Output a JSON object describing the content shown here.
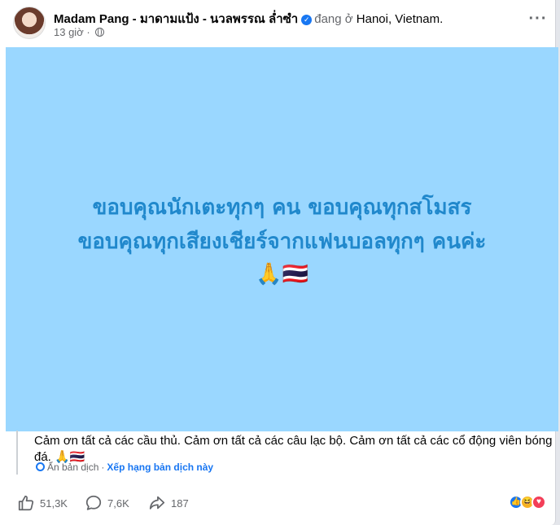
{
  "post": {
    "author": "Madam Pang - มาดามแป้ง - นวลพรรณ ล่ำซำ",
    "checkin_prefix": "đang ở",
    "location": "Hanoi, Vietnam",
    "location_dot": ".",
    "time": "13 giờ",
    "more_label": "···"
  },
  "text_card": {
    "line1": "ขอบคุณนักเตะทุกๆ คน ขอบคุณทุกสโมสร",
    "line2": "ขอบคุณทุกเสียงเชียร์จากแฟนบอลทุกๆ คนค่ะ",
    "line3": "🙏🇹🇭",
    "background": "#9ad7ff",
    "text_color": "#2088cc"
  },
  "translation": {
    "text": "Cảm ơn tất cả các cầu thủ. Cảm ơn tất cả các câu lạc bộ. Cảm ơn tất cả các cổ động viên bóng đá. 🙏🇹🇭",
    "hide_label": "Ẩn bản dịch",
    "separator": "·",
    "rate_label": "Xếp hạng bản dịch này"
  },
  "stats": {
    "likes": "51,3K",
    "comments": "7,6K",
    "shares": "187"
  },
  "icons": {
    "like": "like-icon",
    "comment": "comment-icon",
    "share": "share-icon",
    "globe": "globe-icon",
    "verified": "verified-badge-icon"
  },
  "colors": {
    "accent": "#1877f2",
    "muted": "#65676b"
  }
}
